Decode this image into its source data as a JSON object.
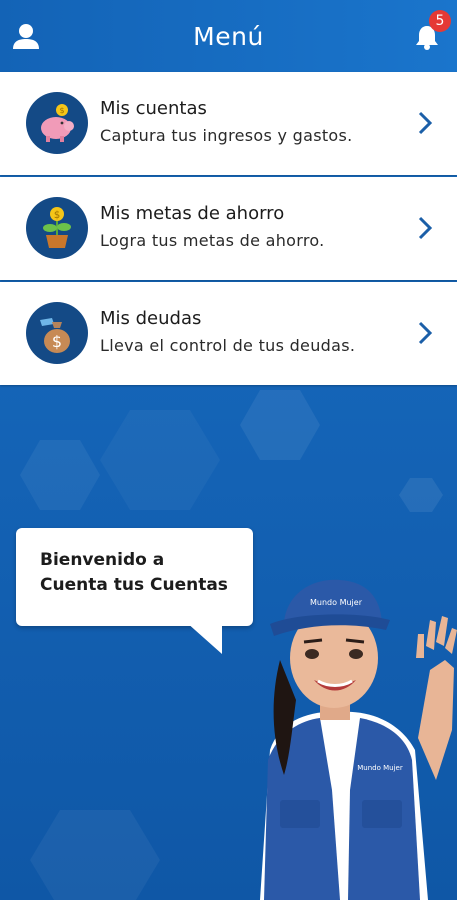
{
  "header": {
    "title": "Menú",
    "notification_count": "5",
    "user_icon": "user-icon",
    "bell_icon": "bell-icon"
  },
  "menu": {
    "items": [
      {
        "title": "Mis cuentas",
        "subtitle": "Captura tus ingresos y gastos.",
        "icon": "piggy-bank-icon"
      },
      {
        "title": "Mis metas de ahorro",
        "subtitle": "Logra tus metas de ahorro.",
        "icon": "plant-coin-icon"
      },
      {
        "title": "Mis deudas",
        "subtitle": "Lleva el control de tus deudas.",
        "icon": "money-bag-icon"
      }
    ]
  },
  "welcome": {
    "line1": "Bienvenido a",
    "line2": "Cuenta tus Cuentas"
  },
  "mascot": {
    "cap_text": "Mundo Mujer",
    "vest_text": "Mundo Mujer"
  },
  "colors": {
    "header": "#1a6fc2",
    "background": "#1565b8",
    "icon_circle": "#144a86",
    "chevron": "#1b5fa8",
    "badge": "#e53935"
  }
}
